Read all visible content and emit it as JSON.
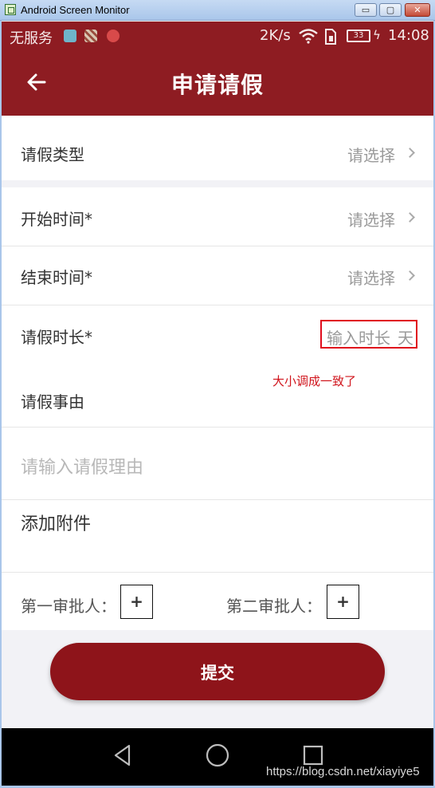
{
  "window": {
    "title": "Android Screen Monitor",
    "min_glyph": "▭",
    "max_glyph": "▢",
    "close_glyph": "✕"
  },
  "status_bar": {
    "carrier": "无服务",
    "speed": "2K/s",
    "battery": "33",
    "time": "14:08"
  },
  "app_bar": {
    "title": "申请请假",
    "back_icon": "arrow-left-icon"
  },
  "form": {
    "leave_type_label": "请假类型",
    "leave_type_value": "请选择",
    "start_time_label": "开始时间*",
    "start_time_value": "请选择",
    "end_time_label": "结束时间*",
    "end_time_value": "请选择",
    "duration_label": "请假时长*",
    "duration_placeholder": "输入时长",
    "duration_unit": "天",
    "reason_label": "请假事由",
    "reason_placeholder": "请输入请假理由",
    "attachment_label": "添加附件",
    "first_approver_label": "第一审批人：",
    "second_approver_label": "第二审批人：",
    "add_glyph": "+",
    "submit_label": "提交"
  },
  "annotation": "大小调成一致了",
  "watermark": "https://blog.csdn.net/xiayiye5",
  "colors": {
    "brand": "#8e1c22",
    "submit": "#8e141a",
    "annotation": "#d0141c"
  }
}
